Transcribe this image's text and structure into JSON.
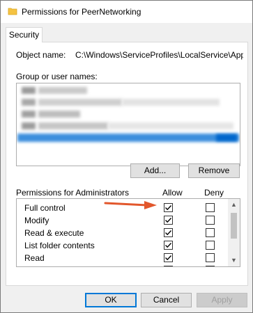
{
  "window": {
    "title": "Permissions for PeerNetworking",
    "icon": "folder-icon"
  },
  "tabs": [
    {
      "label": "Security"
    }
  ],
  "object": {
    "label": "Object name:",
    "value": "C:\\Windows\\ServiceProfiles\\LocalService\\AppData"
  },
  "groups": {
    "label": "Group or user names:",
    "rows": [
      {
        "selected": false,
        "redacted": true
      },
      {
        "selected": false,
        "redacted": true
      },
      {
        "selected": false,
        "redacted": true
      },
      {
        "selected": false,
        "redacted": true
      },
      {
        "selected": true,
        "redacted": true
      }
    ]
  },
  "group_buttons": {
    "add": "Add...",
    "remove": "Remove"
  },
  "permissions": {
    "header": "Permissions for Administrators",
    "allow_label": "Allow",
    "deny_label": "Deny",
    "rows": [
      {
        "name": "Full control",
        "allow": true,
        "deny": false
      },
      {
        "name": "Modify",
        "allow": true,
        "deny": false
      },
      {
        "name": "Read & execute",
        "allow": true,
        "deny": false
      },
      {
        "name": "List folder contents",
        "allow": true,
        "deny": false
      },
      {
        "name": "Read",
        "allow": true,
        "deny": false
      },
      {
        "name": "",
        "allow": true,
        "deny": false
      }
    ]
  },
  "footer": {
    "ok": "OK",
    "cancel": "Cancel",
    "apply": "Apply"
  },
  "colors": {
    "accent": "#0078d7",
    "selection": "#3c8fdd",
    "annotation_arrow": "#e2572c",
    "folder": "#f5c342"
  }
}
